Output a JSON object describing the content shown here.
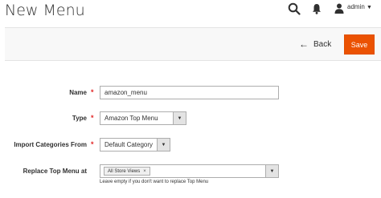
{
  "header": {
    "title": "New Menu",
    "user_label": "admin",
    "search_icon": "search-icon",
    "bell_icon": "bell-icon",
    "user_icon": "user-icon"
  },
  "action_bar": {
    "back_label": "Back",
    "back_icon": "arrow-left-icon",
    "save_label": "Save",
    "save_color": "#eb5202"
  },
  "form": {
    "name": {
      "label": "Name",
      "required": "*",
      "value": "amazon_menu"
    },
    "type": {
      "label": "Type",
      "required": "*",
      "value": "Amazon Top Menu"
    },
    "import_categories": {
      "label": "Import Categories From",
      "required": "*",
      "value": "Default Category"
    },
    "replace_top_menu": {
      "label": "Replace Top Menu at",
      "chips": [
        "All Store Views"
      ],
      "chip_remove": "×",
      "note": "Leave empty if you don't want to replace Top Menu"
    }
  },
  "colors": {
    "required": "#e22626",
    "accent": "#eb5202"
  }
}
